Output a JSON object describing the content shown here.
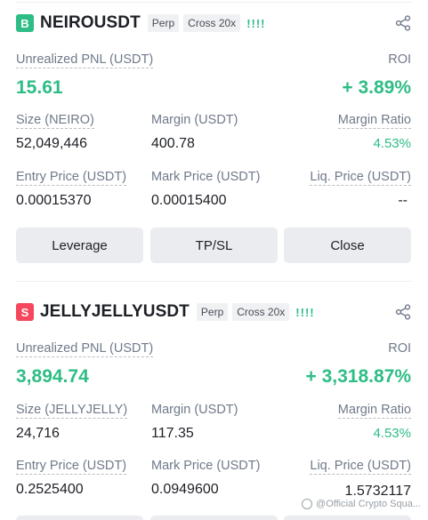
{
  "positions": [
    {
      "badge": "B",
      "symbol": "NEIROUSDT",
      "type_tag": "Perp",
      "margin_tag": "Cross 20x",
      "leverage_bars": "!!!!",
      "pnl_label": "Unrealized PNL (USDT)",
      "pnl_value": "15.61",
      "roi_label": "ROI",
      "roi_value": "+ 3.89%",
      "size_label": "Size (NEIRO)",
      "size_value": "52,049,446",
      "margin_label": "Margin (USDT)",
      "margin_value": "400.78",
      "margin_ratio_label": "Margin Ratio",
      "margin_ratio_value": "4.53%",
      "entry_label": "Entry Price (USDT)",
      "entry_value": "0.00015370",
      "mark_label": "Mark Price (USDT)",
      "mark_value": "0.00015400",
      "liq_label": "Liq. Price (USDT)",
      "liq_value": "--"
    },
    {
      "badge": "S",
      "symbol": "JELLYJELLYUSDT",
      "type_tag": "Perp",
      "margin_tag": "Cross 20x",
      "leverage_bars": "!!!!",
      "pnl_label": "Unrealized PNL (USDT)",
      "pnl_value": "3,894.74",
      "roi_label": "ROI",
      "roi_value": "+ 3,318.87%",
      "size_label": "Size (JELLYJELLY)",
      "size_value": "24,716",
      "margin_label": "Margin (USDT)",
      "margin_value": "117.35",
      "margin_ratio_label": "Margin Ratio",
      "margin_ratio_value": "4.53%",
      "entry_label": "Entry Price (USDT)",
      "entry_value": "0.2525400",
      "mark_label": "Mark Price (USDT)",
      "mark_value": "0.0949600",
      "liq_label": "Liq. Price (USDT)",
      "liq_value": "1.5732117"
    }
  ],
  "buttons": {
    "leverage": "Leverage",
    "tpsl": "TP/SL",
    "close": "Close"
  },
  "watermark": "@Official Crypto Squa...",
  "colors": {
    "positive": "#2ebd85",
    "negative": "#f6465d",
    "button_bg": "#eaecef"
  },
  "icons": {
    "share": "share-icon",
    "watermark": "watermark-logo-icon"
  }
}
